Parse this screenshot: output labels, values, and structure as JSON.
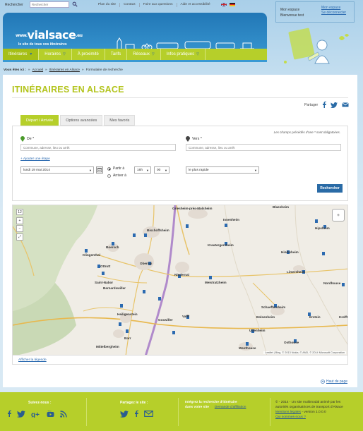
{
  "topbar": {
    "search_label": "Rechercher",
    "search_placeholder": "Rechercher",
    "links": [
      "Plan du site",
      "Contact",
      "Foire aux questions",
      "Aide et accessibilité"
    ]
  },
  "header": {
    "logo_prefix": "www.",
    "logo_main": "vialsace",
    "logo_suffix": ".eu",
    "tagline": "le site de tous vos itinéraires"
  },
  "nav": {
    "items": [
      {
        "label": "Itinéraires"
      },
      {
        "label": "Horaires"
      },
      {
        "label": "À proximité"
      },
      {
        "label": "Tarifs"
      },
      {
        "label": "Réseaux"
      },
      {
        "label": "Infos pratiques"
      }
    ]
  },
  "account": {
    "title": "Mon espace",
    "welcome": "Bienvenue test",
    "link_space": "Mon espace",
    "link_logout": "Se déconnecter"
  },
  "breadcrumb": {
    "prefix": "Vous êtes ici :",
    "home": "Accueil",
    "section": "Itinéraires en Alsace",
    "current": "Formulaire de recherche"
  },
  "main": {
    "title": "ITINÉRAIRES EN ALSACE",
    "share_label": "Partager"
  },
  "tabs": [
    {
      "label": "Départ / Arrivée"
    },
    {
      "label": "Options avancées"
    },
    {
      "label": "Mes favoris"
    }
  ],
  "form": {
    "required_note": "Les champs précédés d'une * sont obligatoires.",
    "from_label": "De *",
    "to_label": "Vers *",
    "from_placeholder": "Commune, adresse, lieu ou arrêt",
    "to_placeholder": "Commune, adresse, lieu ou arrêt",
    "add_step": "+ Ajouter une étape",
    "date_value": "lundi 19 mai 2014",
    "depart_label": "Partir à",
    "arrive_label": "Arriver à",
    "hour_value": "16h",
    "minute_value": "00",
    "mode_value": "le plus rapide",
    "search_button": "Rechercher"
  },
  "map": {
    "zoom_level": "12",
    "attribution": "Leaflet | Bing, © 2013 Nokia, © AND, © 2014 Microsoft Corporation",
    "places": [
      "Griesheim-près-Molsheim",
      "Innenheim",
      "Bischoffsheim",
      "Krautergersheim",
      "Boersch",
      "Klingenthal",
      "Ottrott",
      "Obernai",
      "Niedernai",
      "Meistratzheim",
      "Bernardswiller",
      "Saint-Nabor",
      "Heiligenstein",
      "Goxwiller",
      "Valff",
      "Barr",
      "Mittelbergheim",
      "Hindisheim",
      "Limersheim",
      "Nordhouse",
      "Schaeffersheim",
      "Bolsenheim",
      "Uttenheim",
      "Osthouse",
      "Westhouse",
      "Erstein",
      "Krafft",
      "Blaesheim",
      "Hipsheim"
    ]
  },
  "legend_link": "Afficher la légende",
  "back_to_top": "Haut de page",
  "footer": {
    "follow_title": "Suivez-nous :",
    "share_title": "Partagez le site :",
    "integrate_title": "Intégrez la recherche d'itinéraire",
    "integrate_line2": "dans votre site",
    "integrate_link": "Demande d'affiliation",
    "about_line1": "© - 2014 - Un site multimodal animé par les",
    "about_line2": "autorités organisatrices de transport d'Alsace",
    "about_link": "Mentions légales",
    "version": " - version 1.0.0.0",
    "feedback": "Qui sommes-nous ?"
  },
  "colors": {
    "accent_green": "#b6cf2a",
    "brand_blue": "#2277b6",
    "link_blue": "#2b6ab0"
  }
}
